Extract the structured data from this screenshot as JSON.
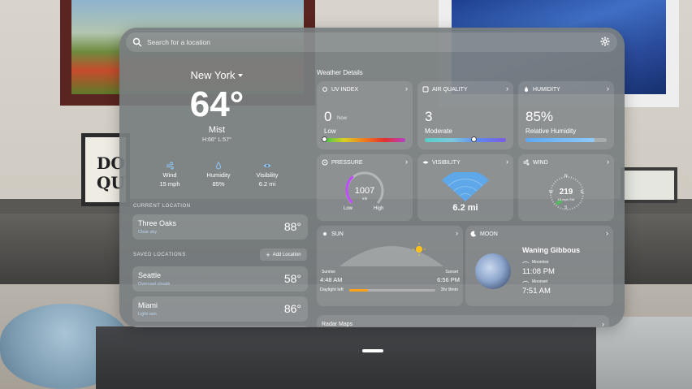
{
  "search": {
    "placeholder": "Search for a location"
  },
  "current": {
    "city": "New York",
    "temperature": "64°",
    "condition": "Mist",
    "hilo": "H:66° L:57°",
    "metrics": [
      {
        "label": "Wind",
        "value": "15 mph",
        "icon": "wind-icon"
      },
      {
        "label": "Humidity",
        "value": "85%",
        "icon": "droplet-icon"
      },
      {
        "label": "Visibility",
        "value": "6.2 mi",
        "icon": "eye-icon"
      }
    ]
  },
  "current_location": {
    "label": "CURRENT LOCATION",
    "name": "Three Oaks",
    "condition": "Clear sky",
    "temp": "88°"
  },
  "saved": {
    "label": "SAVED LOCATIONS",
    "add_label": "Add Location",
    "items": [
      {
        "name": "Seattle",
        "condition": "Overcast clouds",
        "temp": "58°"
      },
      {
        "name": "Miami",
        "condition": "Light rain",
        "temp": "86°"
      }
    ]
  },
  "details": {
    "title": "Weather Details",
    "uv": {
      "title": "UV INDEX",
      "value": "0",
      "now": "Now",
      "label": "Low",
      "level": 0.0
    },
    "air": {
      "title": "AIR QUALITY",
      "value": "3",
      "label": "Moderate",
      "level": 0.6
    },
    "humidity": {
      "title": "HUMIDITY",
      "value": "85%",
      "label": "Relative Humidity",
      "level": 0.85
    },
    "pressure": {
      "title": "PRESSURE",
      "value": "1007",
      "unit": "mb",
      "low": "Low",
      "high": "High",
      "level": 0.35
    },
    "visibility": {
      "title": "VISIBILITY",
      "value": "6.2 mi"
    },
    "wind": {
      "title": "WIND",
      "speed": "219",
      "sub": "15 mph SW",
      "n": "N",
      "s": "S",
      "e": "E",
      "w": "W"
    },
    "sun": {
      "title": "SUN",
      "sunrise_label": "Sunrise",
      "sunrise": "4:48 AM",
      "sunset_label": "Sunset",
      "sunset": "6:56 PM",
      "daylight_label": "Daylight left",
      "daylight": "3hr 8min",
      "daylight_level": 0.22
    },
    "moon": {
      "title": "MOON",
      "phase": "Waning Gibbous",
      "moonrise_label": "Moonrise",
      "moonrise": "11:08 PM",
      "moonset_label": "Moonset",
      "moonset": "7:51 AM"
    },
    "radar": {
      "title": "Radar Maps"
    }
  },
  "colors": {
    "accent": "#8ecbff",
    "gauge": "#c04bff",
    "visibility": "#5ea7e8",
    "compass": "#55b85e",
    "sun": "#ffc21a"
  }
}
